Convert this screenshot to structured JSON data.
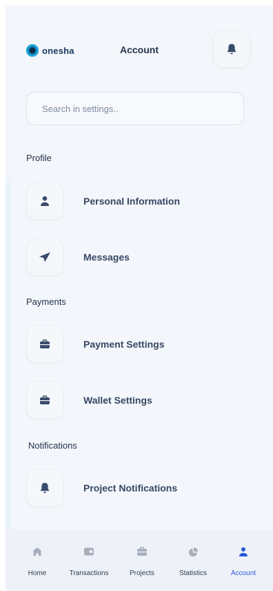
{
  "header": {
    "brand": "onesha",
    "title": "Account",
    "notifications_icon": "bell-icon"
  },
  "search": {
    "placeholder": "Search in settings.."
  },
  "sections": {
    "profile": {
      "label": "Profile",
      "items": [
        {
          "label": "Personal Information",
          "icon": "user-icon"
        },
        {
          "label": "Messages",
          "icon": "send-icon"
        }
      ]
    },
    "payments": {
      "label": "Payments",
      "items": [
        {
          "label": "Payment Settings",
          "icon": "briefcase-icon"
        },
        {
          "label": "Wallet Settings",
          "icon": "briefcase-icon"
        }
      ]
    },
    "notifications": {
      "label": "Notifications",
      "items": [
        {
          "label": "Project Notifications",
          "icon": "bell-icon"
        }
      ]
    }
  },
  "tabbar": {
    "tabs": [
      {
        "label": "Home",
        "icon": "home-icon"
      },
      {
        "label": "Transactions",
        "icon": "wallet-icon"
      },
      {
        "label": "Projects",
        "icon": "briefcase-icon"
      },
      {
        "label": "Statistics",
        "icon": "pie-chart-icon"
      },
      {
        "label": "Account",
        "icon": "user-icon",
        "active": true
      }
    ]
  },
  "colors": {
    "background": "#f3f6fb",
    "icon": "#3a4b6b",
    "accent": "#2b59d9",
    "tab_icon": "#a6aebb"
  }
}
